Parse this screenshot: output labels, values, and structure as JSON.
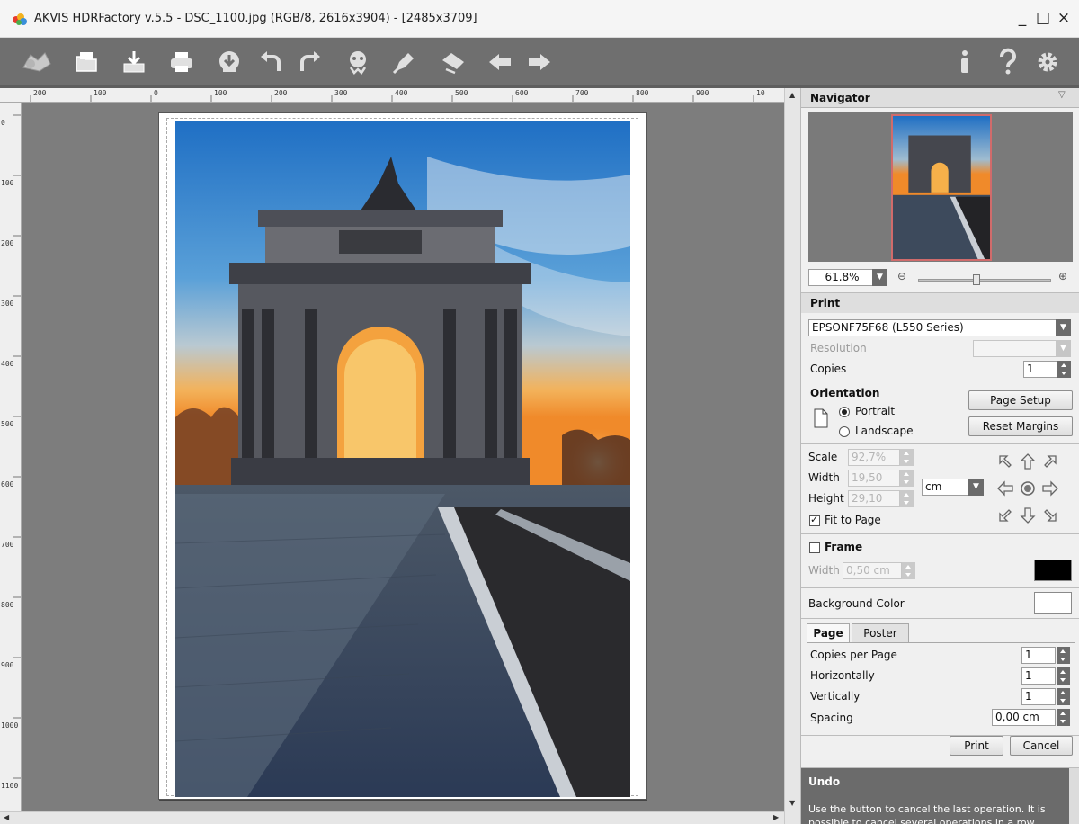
{
  "window": {
    "title": "AKVIS HDRFactory v.5.5 - DSC_1100.jpg (RGB/8, 2616x3904) - [2485x3709]",
    "minimize": "_",
    "maximize": "□",
    "close": "×"
  },
  "toolbar": {
    "left_icons": [
      "hdr-logo-icon",
      "open-icon",
      "save-icon",
      "print-icon",
      "share-icon",
      "undo-icon",
      "redo-icon",
      "presets-icon",
      "brush-icon",
      "eraser-icon",
      "back-icon",
      "forward-icon"
    ],
    "right_icons": [
      "info-icon",
      "help-icon",
      "settings-icon"
    ]
  },
  "ruler": {
    "top": [
      "200",
      "100",
      "0",
      "100",
      "200",
      "300",
      "400",
      "500",
      "600",
      "700",
      "800",
      "900",
      "10"
    ],
    "left": [
      "0",
      "100",
      "200",
      "300",
      "400",
      "500",
      "600",
      "700",
      "800",
      "900",
      "1000",
      "1100"
    ]
  },
  "navigator": {
    "title": "Navigator",
    "zoom": "61.8%"
  },
  "print": {
    "title": "Print",
    "printer": "EPSONF75F68 (L550 Series)",
    "resolution_label": "Resolution",
    "resolution_value": "",
    "copies_label": "Copies",
    "copies_value": "1"
  },
  "orientation": {
    "title": "Orientation",
    "portrait": "Portrait",
    "landscape": "Landscape",
    "selected": "Portrait",
    "page_setup": "Page Setup",
    "reset_margins": "Reset Margins"
  },
  "scale": {
    "scale_label": "Scale",
    "scale_value": "92,7%",
    "width_label": "Width",
    "width_value": "19,50",
    "height_label": "Height",
    "height_value": "29,10",
    "unit": "cm",
    "fit_to_page": "Fit to Page",
    "fit_to_page_checked": true
  },
  "frame": {
    "title": "Frame",
    "checked": false,
    "width_label": "Width",
    "width_value": "0,50 cm",
    "color": "#000000"
  },
  "background": {
    "label": "Background Color",
    "color": "#ffffff"
  },
  "tabs": {
    "page": "Page",
    "poster": "Poster",
    "active": "Page"
  },
  "page_settings": {
    "copies_per_page_label": "Copies per Page",
    "copies_per_page": "1",
    "horizontally_label": "Horizontally",
    "horizontally": "1",
    "vertically_label": "Vertically",
    "vertically": "1",
    "spacing_label": "Spacing",
    "spacing": "0,00 cm"
  },
  "actions": {
    "print": "Print",
    "cancel": "Cancel"
  },
  "undo": {
    "title": "Undo",
    "text": "Use the button to cancel the last operation. It is possible to cancel several operations in a row."
  },
  "colors": {
    "toolbar_bg": "#6f6f6f",
    "workarea_bg": "#7d7d7d",
    "undo_bg": "#6b6b6b"
  }
}
